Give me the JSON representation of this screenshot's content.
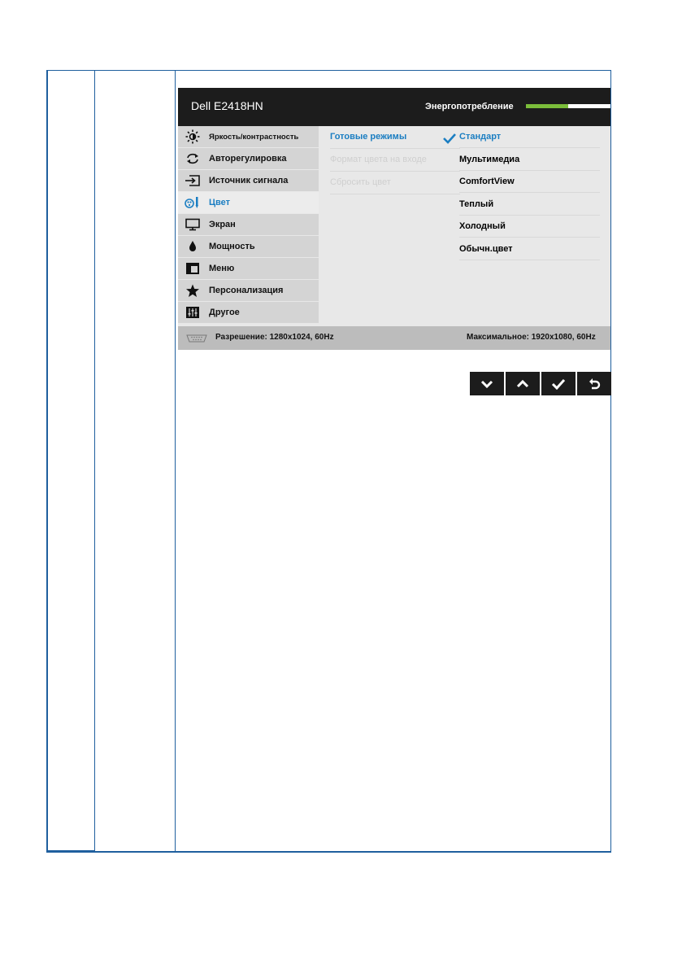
{
  "header": {
    "model": "Dell E2418HN",
    "energy_label": "Энергопотребление",
    "energy_level_fraction": 0.5
  },
  "menu": {
    "items": [
      {
        "icon": "brightness-icon",
        "label": "Яркость/контрастность"
      },
      {
        "icon": "auto-adjust-icon",
        "label": "Авторегулировка"
      },
      {
        "icon": "input-source-icon",
        "label": "Источник сигнала"
      },
      {
        "icon": "color-icon",
        "label": "Цвет"
      },
      {
        "icon": "display-icon",
        "label": "Экран"
      },
      {
        "icon": "power-icon",
        "label": "Мощность"
      },
      {
        "icon": "menu-icon",
        "label": "Меню"
      },
      {
        "icon": "star-icon",
        "label": "Персонализация"
      },
      {
        "icon": "others-icon",
        "label": "Другое"
      }
    ],
    "active": "Цвет"
  },
  "submenu": {
    "items": [
      "Готовые режимы",
      "Формат цвета на входе",
      "Сбросить цвет"
    ]
  },
  "options": {
    "items": [
      "Стандарт",
      "Мультимедиа",
      "ComfortView",
      "Теплый",
      "Холодный",
      "Обычн.цвет"
    ],
    "selected": "Стандарт"
  },
  "footer": {
    "resolution": "Разрешение: 1280x1024, 60Hz",
    "maximum": "Максимальное: 1920x1080, 60Hz"
  },
  "buttons": [
    "down-icon",
    "up-icon",
    "check-icon",
    "back-icon"
  ],
  "colors": {
    "accent": "#1b7ec2",
    "energy": "#7bbd3a",
    "header_bg": "#1c1c1c"
  }
}
